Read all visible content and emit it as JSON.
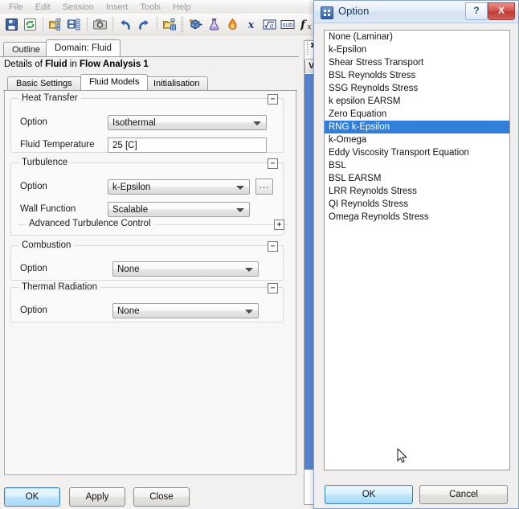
{
  "app": {
    "menubar": [
      "File",
      "Edit",
      "Session",
      "Insert",
      "Tools",
      "Help"
    ],
    "toolbar_icons": [
      "save-icon",
      "refresh-icon",
      "open-tree-icon",
      "save-tree-icon",
      "snapshot-icon",
      "undo-icon",
      "redo-icon",
      "open-mesh-icon",
      "domain-icon",
      "material-flask-icon",
      "reaction-flame-icon",
      "expression-icon",
      "variable-icon",
      "subdomain-icon",
      "function-icon"
    ]
  },
  "tabs": {
    "items": [
      {
        "label": "Outline",
        "active": false
      },
      {
        "label": "Domain: Fluid",
        "active": true
      }
    ],
    "close_label": "✖"
  },
  "details": {
    "prefix": "Details of ",
    "object": "Fluid",
    "middle": " in ",
    "context": "Flow Analysis 1"
  },
  "subtabs": [
    {
      "label": "Basic Settings",
      "active": false
    },
    {
      "label": "Fluid Models",
      "active": true
    },
    {
      "label": "Initialisation",
      "active": false
    }
  ],
  "groups": {
    "heat_transfer": {
      "title": "Heat Transfer",
      "collapse_glyph": "−",
      "option_label": "Option",
      "option_value": "Isothermal",
      "temperature_label": "Fluid Temperature",
      "temperature_value": "25 [C]"
    },
    "turbulence": {
      "title": "Turbulence",
      "collapse_glyph": "−",
      "option_label": "Option",
      "option_value": "k-Epsilon",
      "ellipsis_label": "...",
      "wall_function_label": "Wall Function",
      "wall_function_value": "Scalable",
      "advanced_label": "Advanced Turbulence Control",
      "advanced_glyph": "+"
    },
    "combustion": {
      "title": "Combustion",
      "collapse_glyph": "−",
      "option_label": "Option",
      "option_value": "None"
    },
    "thermal_radiation": {
      "title": "Thermal Radiation",
      "collapse_glyph": "−",
      "option_label": "Option",
      "option_value": "None"
    }
  },
  "main_buttons": {
    "ok": "OK",
    "apply": "Apply",
    "close": "Close"
  },
  "viewer": {
    "tab_label": "Vie",
    "star_glyph": "✱"
  },
  "dialog": {
    "title": "Option",
    "icon": "grid-window-icon",
    "help_label": "?",
    "close_label": "X",
    "list_items": [
      {
        "label": "None (Laminar)",
        "selected": false
      },
      {
        "label": "k-Epsilon",
        "selected": false
      },
      {
        "label": "Shear Stress Transport",
        "selected": false
      },
      {
        "label": "BSL Reynolds Stress",
        "selected": false
      },
      {
        "label": "SSG Reynolds Stress",
        "selected": false
      },
      {
        "label": "k epsilon EARSM",
        "selected": false
      },
      {
        "label": "Zero Equation",
        "selected": false
      },
      {
        "label": "RNG k-Epsilon",
        "selected": true
      },
      {
        "label": "k-Omega",
        "selected": false
      },
      {
        "label": "Eddy Viscosity Transport Equation",
        "selected": false
      },
      {
        "label": "BSL",
        "selected": false
      },
      {
        "label": "BSL EARSM",
        "selected": false
      },
      {
        "label": "LRR Reynolds Stress",
        "selected": false
      },
      {
        "label": "QI Reynolds Stress",
        "selected": false
      },
      {
        "label": "Omega Reynolds Stress",
        "selected": false
      }
    ],
    "buttons": {
      "ok": "OK",
      "cancel": "Cancel"
    }
  },
  "colors": {
    "selection_blue": "#2f7fdb",
    "close_red": "#c23a34",
    "default_button_blue": "#bee6fd",
    "viewer_blue": "#4f7fd0"
  }
}
